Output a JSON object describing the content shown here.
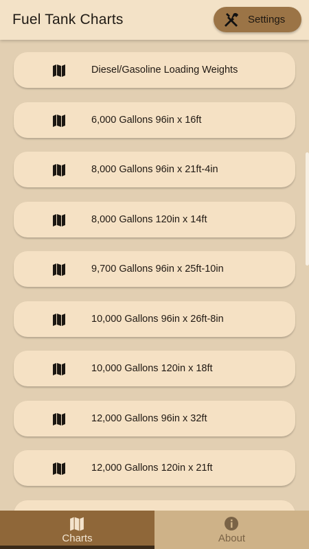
{
  "header": {
    "title": "Fuel Tank Charts",
    "settings_label": "Settings"
  },
  "charts": [
    {
      "label": "Diesel/Gasoline Loading Weights"
    },
    {
      "label": "6,000 Gallons 96in x 16ft"
    },
    {
      "label": "8,000 Gallons 96in x 21ft-4in"
    },
    {
      "label": "8,000 Gallons 120in x 14ft"
    },
    {
      "label": "9,700 Gallons 96in x 25ft-10in"
    },
    {
      "label": "10,000 Gallons 96in x 26ft-8in"
    },
    {
      "label": "10,000 Gallons 120in x 18ft"
    },
    {
      "label": "12,000 Gallons 96in x 32ft"
    },
    {
      "label": "12,000 Gallons 120in x 21ft"
    }
  ],
  "icons": {
    "list_item": "map-icon",
    "settings": "tools-icon",
    "charts_tab": "map-icon",
    "about_tab": "info-icon"
  },
  "bottom_nav": {
    "charts_label": "Charts",
    "about_label": "About",
    "selected": "Charts"
  },
  "colors": {
    "background": "#e2cfb2",
    "app_bar": "#f3e2c7",
    "card": "#f5e1c4",
    "accent": "#9b7446",
    "selected_tab": "#8f6739",
    "inactive_tab": "#ceb288"
  }
}
